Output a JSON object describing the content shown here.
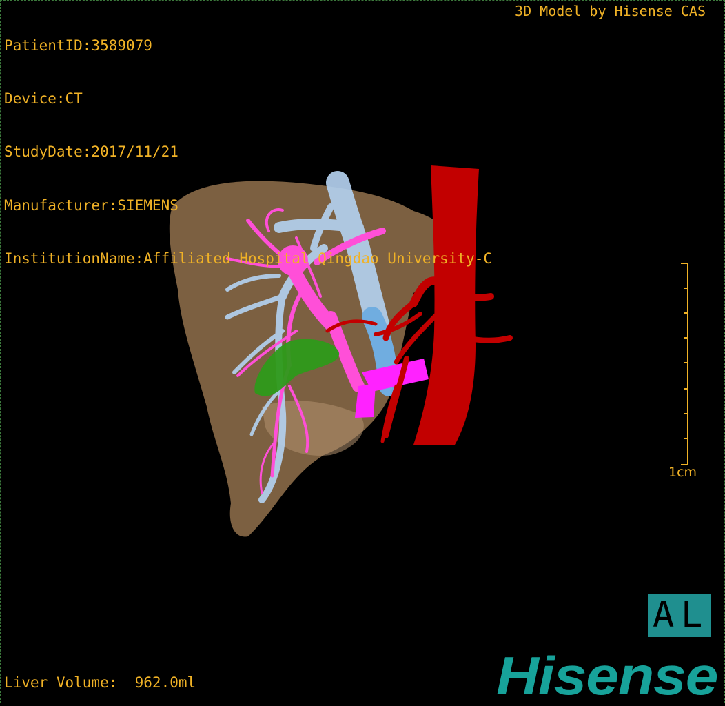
{
  "header": {
    "patient_id": "PatientID:3589079",
    "device": "Device:CT",
    "study_date": "StudyDate:2017/11/21",
    "manufacturer": "Manufacturer:SIEMENS",
    "institution": "InstitutionName:Affiliated Hospital Qingdao University-C"
  },
  "credit": "3D Model by Hisense CAS",
  "volume_label": "Liver Volume:  962.0ml",
  "scale_bar": {
    "unit_label": "1cm"
  },
  "orientation": {
    "left": "A",
    "right": "L"
  },
  "logo_text": "Hisense",
  "colors": {
    "text": "#f0b226",
    "liver": "#8a6a48",
    "hepatic_vein": "#ff4fd8",
    "portal_vein": "#b3d0ee",
    "artery": "#c20000",
    "gallbladder": "#2e9a1a",
    "ivc": "#ff22ff",
    "logo": "#17a29a"
  }
}
